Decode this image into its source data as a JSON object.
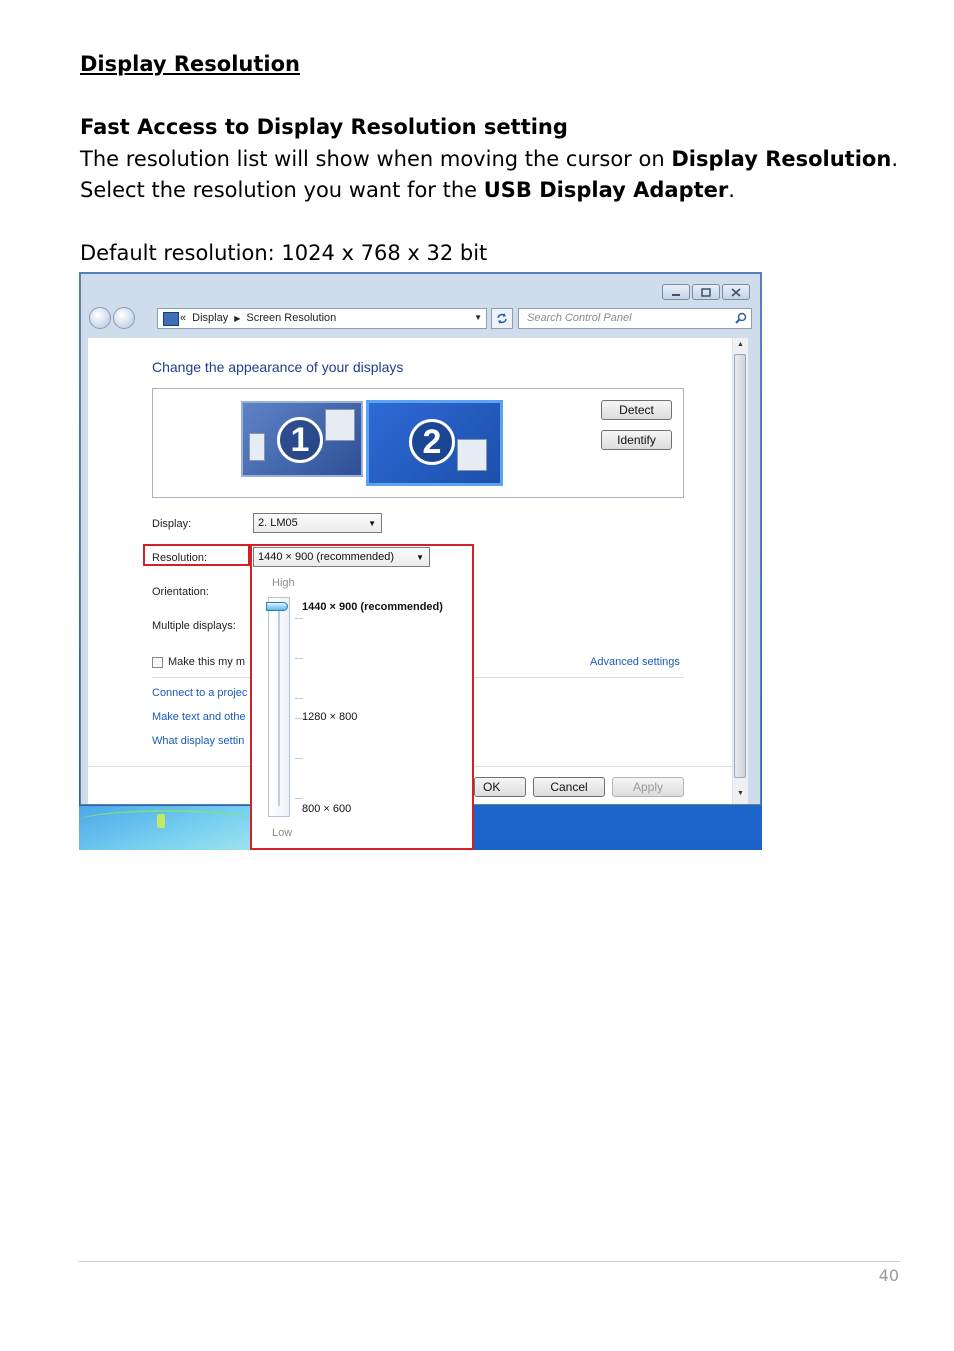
{
  "doc": {
    "title": "Display Resolution",
    "section_title": "Fast Access to Display Resolution setting",
    "para1_pre": "The resolution list will show when moving the cursor on ",
    "para1_bold": "Display Resolution",
    "para1_post": ".",
    "para2_pre": "Select the resolution you want for the ",
    "para2_bold": "USB Display Adapter",
    "para2_post": ".",
    "default_res": "Default resolution: 1024 x 768 x 32 bit",
    "page_number": "40"
  },
  "window": {
    "breadcrumb_sep": "«",
    "breadcrumb": [
      "Display",
      "Screen Resolution"
    ],
    "search_placeholder": "Search Control Panel",
    "heading": "Change the appearance of your displays",
    "monitor1": "1",
    "monitor2": "2",
    "detect_label": "Detect",
    "identify_label": "Identify",
    "display_label": "Display:",
    "display_value": "2. LM05",
    "resolution_label": "Resolution:",
    "resolution_value": "1440 × 900 (recommended)",
    "orientation_label": "Orientation:",
    "multiple_label": "Multiple displays:",
    "make_main_label": "Make this my m",
    "advanced_link": "Advanced settings",
    "links": [
      "Connect to a projec",
      "Make text and othe",
      "What display settin"
    ],
    "ok_label": "OK",
    "cancel_label": "Cancel",
    "apply_label": "Apply"
  },
  "flyout": {
    "high_label": "High",
    "low_label": "Low",
    "options": [
      "1440 × 900 (recommended)",
      "1280 × 800",
      "800 × 600"
    ],
    "selected_index": 0
  },
  "colors": {
    "highlight_red": "#d42027",
    "link_blue": "#1a5bb8",
    "heading_blue": "#1e3e8f"
  }
}
